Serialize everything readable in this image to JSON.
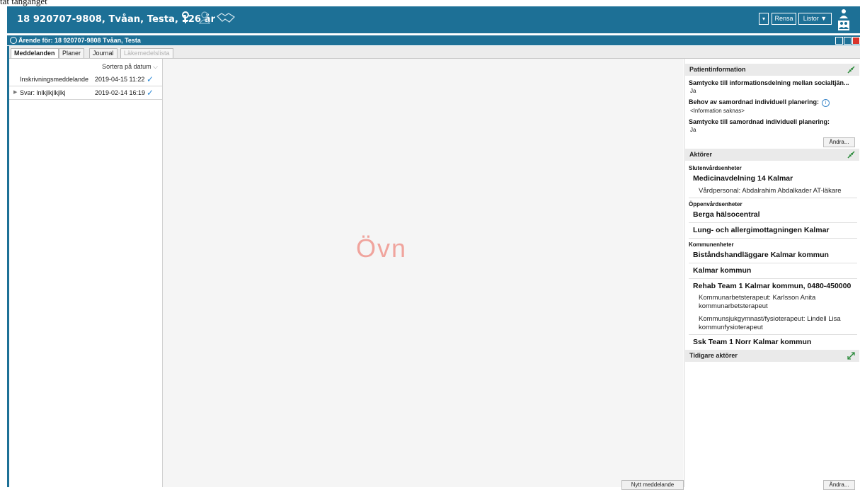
{
  "top_clip_text": "tät tänganget",
  "header": {
    "patient": "18 920707-9808, Tvåan, Testa, 126 år",
    "rensa": "Rensa",
    "listor": "Listor ▼",
    "filter_icon": "filter-icon",
    "colors": {
      "primary": "#1d7096"
    }
  },
  "subheader": {
    "title": "Ärende för: 18 920707-9808 Tvåan, Testa"
  },
  "tabs": [
    {
      "label": "Meddelanden",
      "state": "active"
    },
    {
      "label": "Planer",
      "state": "normal"
    },
    {
      "label": "Journal",
      "state": "normal"
    },
    {
      "label": "Läkemedelslista",
      "state": "disabled"
    }
  ],
  "messages": {
    "sort_label": "Sortera på datum",
    "rows": [
      {
        "name": "Inskrivningsmeddelande",
        "date": "2019-04-15 11:22"
      },
      {
        "name": "Svar: lnlkjlkjlkjlkj",
        "date": "2019-02-14 16:19"
      }
    ]
  },
  "center": {
    "watermark": "Övn",
    "new_message": "Nytt meddelande"
  },
  "patientinfo": {
    "title": "Patientinformation",
    "q1": "Samtycke till informationsdelning mellan socialtjän...",
    "a1": "Ja",
    "q2": "Behov av samordnad individuell planering:",
    "a2": "<Information saknas>",
    "q3": "Samtycke till samordnad individuell planering:",
    "a3": "Ja",
    "andra": "Ändra..."
  },
  "aktorer": {
    "title": "Aktörer",
    "slutenvard": "Slutenvårdsenheter",
    "medicin": "Medicinavdelning 14 Kalmar",
    "vardpersonal": "Vårdpersonal: Abdalrahim Abdalkader AT-läkare",
    "oppenvard": "Öppenvårdsenheter",
    "berga": "Berga hälsocentral",
    "lung": "Lung- och allergimottagningen Kalmar",
    "kommun": "Kommunenheter",
    "bistand": "Biståndshandläggare Kalmar kommun",
    "kalmar": "Kalmar kommun",
    "rehab": "Rehab Team 1 Kalmar kommun, 0480-450000",
    "kommunarb_1": "Kommunarbetsterapeut: Karlsson Anita",
    "kommunarb_2": "kommunarbetsterapeut",
    "kommunsjuk_1": "Kommunsjukgymnast/fysioterapeut: Lindell Lisa",
    "kommunsjuk_2": "kommunfysioterapeut",
    "ssk": "Ssk Team 1 Norr Kalmar kommun"
  },
  "tidigare": {
    "title": "Tidigare aktörer",
    "andra": "Ändra..."
  }
}
